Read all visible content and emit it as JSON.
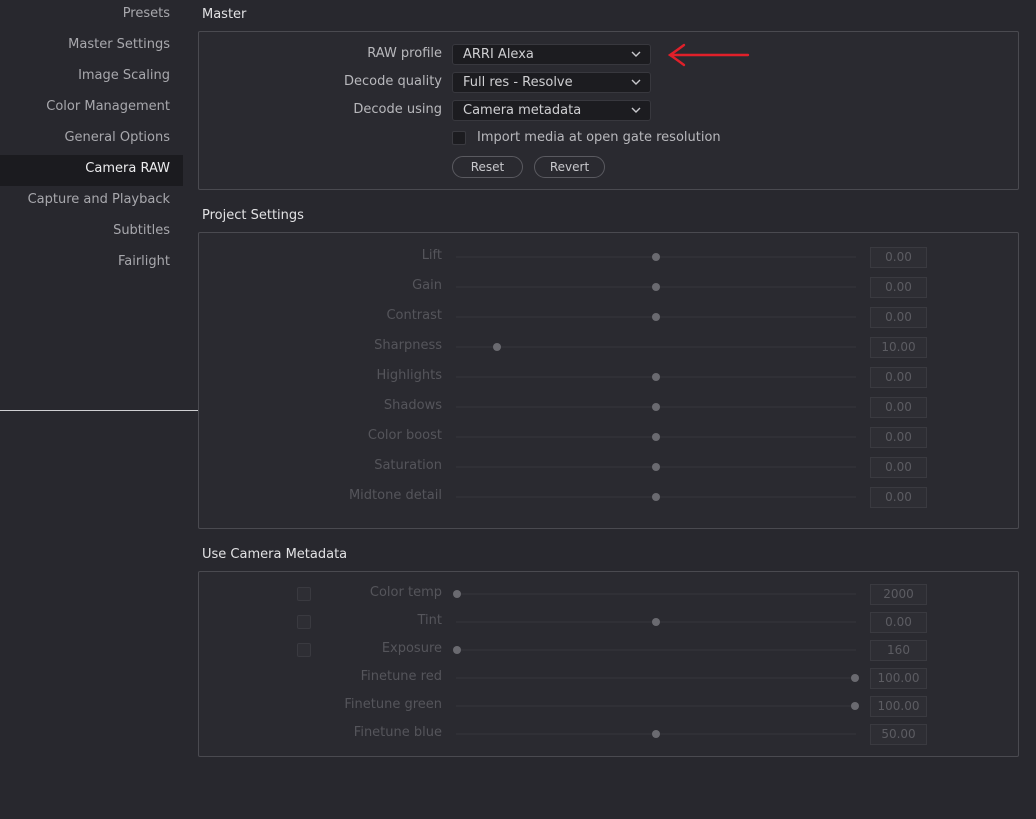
{
  "sidebar": {
    "items": [
      {
        "label": "Presets",
        "active": false
      },
      {
        "label": "Master Settings",
        "active": false
      },
      {
        "label": "Image Scaling",
        "active": false
      },
      {
        "label": "Color Management",
        "active": false
      },
      {
        "label": "General Options",
        "active": false
      },
      {
        "label": "Camera RAW",
        "active": true
      },
      {
        "label": "Capture and Playback",
        "active": false
      },
      {
        "label": "Subtitles",
        "active": false
      },
      {
        "label": "Fairlight",
        "active": false
      }
    ]
  },
  "master": {
    "title": "Master",
    "raw_profile": {
      "label": "RAW profile",
      "value": "ARRI Alexa"
    },
    "decode_quality": {
      "label": "Decode quality",
      "value": "Full res - Resolve"
    },
    "decode_using": {
      "label": "Decode using",
      "value": "Camera metadata"
    },
    "open_gate": {
      "label": "Import media at open gate resolution",
      "checked": false
    },
    "reset_label": "Reset",
    "revert_label": "Revert"
  },
  "project_settings": {
    "title": "Project Settings",
    "sliders": [
      {
        "label": "Lift",
        "value": "0.00",
        "fraction": 0.5
      },
      {
        "label": "Gain",
        "value": "0.00",
        "fraction": 0.5
      },
      {
        "label": "Contrast",
        "value": "0.00",
        "fraction": 0.5
      },
      {
        "label": "Sharpness",
        "value": "10.00",
        "fraction": 0.1
      },
      {
        "label": "Highlights",
        "value": "0.00",
        "fraction": 0.5
      },
      {
        "label": "Shadows",
        "value": "0.00",
        "fraction": 0.5
      },
      {
        "label": "Color boost",
        "value": "0.00",
        "fraction": 0.5
      },
      {
        "label": "Saturation",
        "value": "0.00",
        "fraction": 0.5
      },
      {
        "label": "Midtone detail",
        "value": "0.00",
        "fraction": 0.5
      }
    ]
  },
  "camera_metadata": {
    "title": "Use Camera Metadata",
    "sliders": [
      {
        "label": "Color temp",
        "value": "2000",
        "fraction": 0.0,
        "checkbox": true
      },
      {
        "label": "Tint",
        "value": "0.00",
        "fraction": 0.5,
        "checkbox": true
      },
      {
        "label": "Exposure",
        "value": "160",
        "fraction": 0.0,
        "checkbox": true
      },
      {
        "label": "Finetune red",
        "value": "100.00",
        "fraction": 1.0,
        "checkbox": false
      },
      {
        "label": "Finetune green",
        "value": "100.00",
        "fraction": 1.0,
        "checkbox": false
      },
      {
        "label": "Finetune blue",
        "value": "50.00",
        "fraction": 0.5,
        "checkbox": false
      }
    ]
  },
  "colors": {
    "accent_arrow": "#e0202a",
    "active_bg": "#1b1b1f"
  }
}
